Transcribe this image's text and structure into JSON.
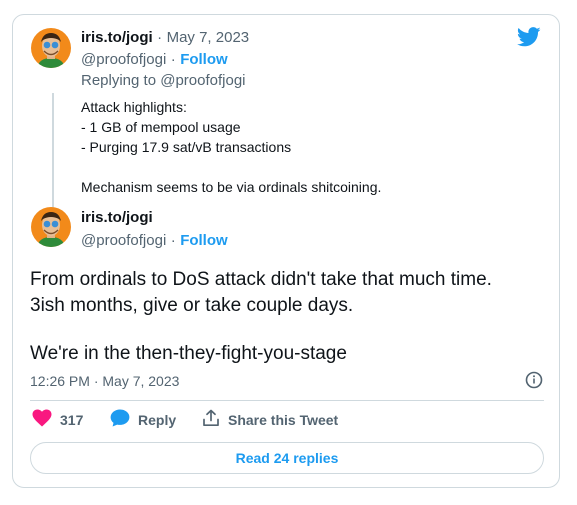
{
  "reply_tweet": {
    "display_name": "iris.to/jogi",
    "separator": "·",
    "date": "May 7, 2023",
    "handle": "@proofofjogi",
    "follow_label": "Follow",
    "replying_to_label": "Replying to @proofofjogi",
    "lines": [
      "Attack highlights:",
      "- 1 GB of mempool usage",
      "- Purging 17.9 sat/vB transactions",
      "",
      "Mechanism seems to be via ordinals shitcoining."
    ]
  },
  "main_tweet": {
    "display_name": "iris.to/jogi",
    "handle": "@proofofjogi",
    "separator": "·",
    "follow_label": "Follow",
    "lines": [
      "From ordinals to DoS attack didn't take that much time.",
      "3ish months, give or take couple days.",
      "",
      "We're in the then-they-fight-you-stage"
    ],
    "timestamp": "12:26 PM · May 7, 2023"
  },
  "actions": {
    "like_count": "317",
    "reply_label": "Reply",
    "share_label": "Share this Tweet"
  },
  "read_replies_label": "Read 24 replies",
  "icons": {
    "brand": "twitter-bird-icon",
    "like": "heart-icon",
    "reply": "speech-bubble-icon",
    "share": "share-icon",
    "info": "info-icon"
  },
  "colors": {
    "accent": "#1d9bf0",
    "like": "#f91880",
    "muted": "#536471",
    "border": "#cfd9de"
  }
}
